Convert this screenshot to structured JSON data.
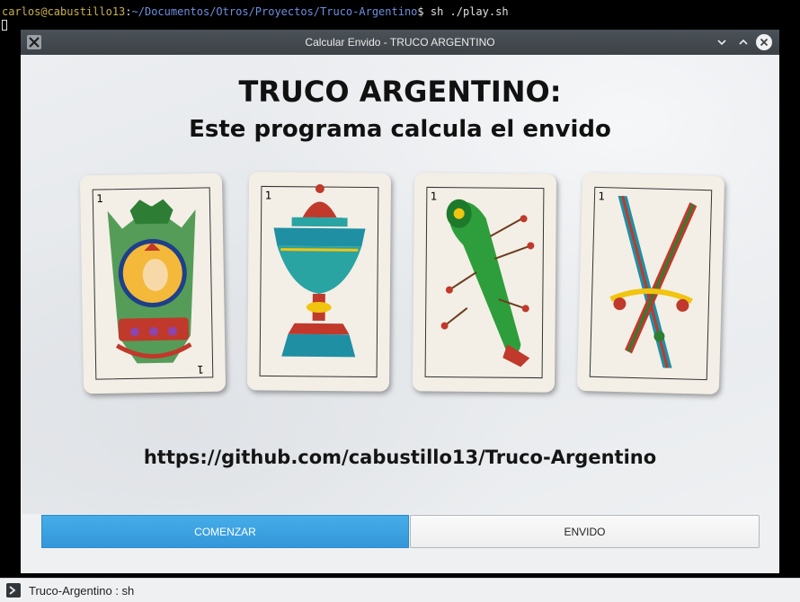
{
  "terminal": {
    "user_host": "carlos@cabustillo13",
    "sep": ":",
    "path": "~/Documentos/Otros/Proyectos/Truco-Argentino",
    "prompt_cmd": "$ sh ./play.sh"
  },
  "window": {
    "title": "Calcular Envido - TRUCO ARGENTINO"
  },
  "hero": {
    "title": "TRUCO ARGENTINO:",
    "subtitle": "Este programa calcula el envido",
    "url": "https://github.com/cabustillo13/Truco-Argentino",
    "cards": [
      {
        "number": "1",
        "suit": "oros-icon"
      },
      {
        "number": "1",
        "suit": "copas-icon"
      },
      {
        "number": "1",
        "suit": "bastos-icon"
      },
      {
        "number": "1",
        "suit": "espadas-icon"
      }
    ]
  },
  "buttons": {
    "start_label": "COMENZAR",
    "envido_label": "ENVIDO"
  },
  "taskbar": {
    "item_label": "Truco-Argentino : sh"
  },
  "colors": {
    "accent": "#3daee9",
    "titlebar": "#454a4f",
    "terminal_user": "#c9b14a",
    "terminal_path": "#6d8fe0"
  }
}
